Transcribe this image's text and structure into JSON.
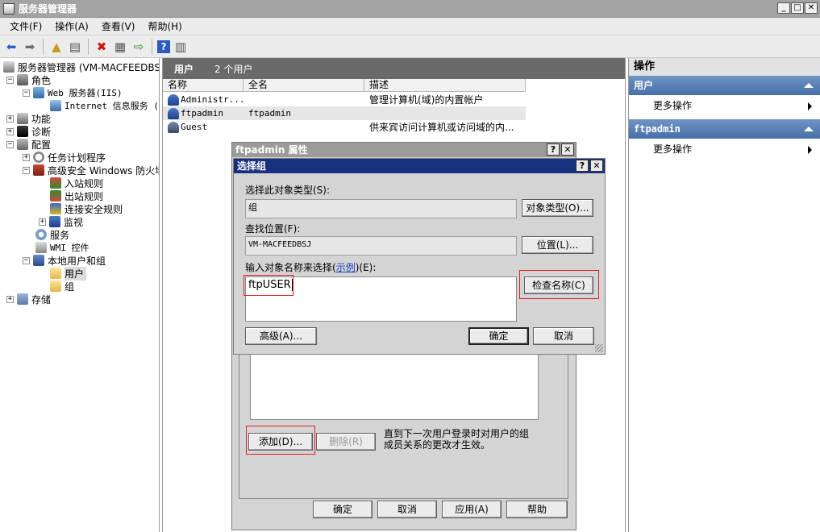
{
  "window": {
    "title": "服务器管理器"
  },
  "menu": [
    "文件(F)",
    "操作(A)",
    "查看(V)",
    "帮助(H)"
  ],
  "tree": {
    "root": "服务器管理器 (VM-MACFEEDBSJ)",
    "roles": "角色",
    "web_server": "Web 服务器(IIS)",
    "iis_manager": "Internet 信息服务 (",
    "features": "功能",
    "diagnostics": "诊断",
    "config": "配置",
    "task_scheduler": "任务计划程序",
    "firewall": "高级安全 Windows 防火墙",
    "inbound": "入站规则",
    "outbound": "出站规则",
    "connection_rules": "连接安全规则",
    "monitor": "监视",
    "services": "服务",
    "wmi": "WMI 控件",
    "local_users_groups": "本地用户和组",
    "users": "用户",
    "groups": "组",
    "storage": "存储"
  },
  "center": {
    "header_title": "用户",
    "header_count": "2 个用户",
    "columns": [
      "名称",
      "全名",
      "描述"
    ],
    "rows": [
      {
        "name": "Administr...",
        "fullname": "",
        "desc": "管理计算机(域)的内置帐户"
      },
      {
        "name": "ftpadmin",
        "fullname": "ftpadmin",
        "desc": ""
      },
      {
        "name": "Guest",
        "fullname": "",
        "desc": "供来宾访问计算机或访问域的内..."
      }
    ]
  },
  "actions": {
    "title": "操作",
    "sections": [
      {
        "header": "用户",
        "item": "更多操作"
      },
      {
        "header": "ftpadmin",
        "item": "更多操作"
      }
    ]
  },
  "properties_dialog": {
    "title": "ftpadmin 属性",
    "add_button": "添加(D)...",
    "remove_button": "删除(R)",
    "note_line1": "直到下一次用户登录时对用户的组",
    "note_line2": "成员关系的更改才生效。",
    "ok": "确定",
    "cancel": "取消",
    "apply": "应用(A)",
    "help": "帮助"
  },
  "select_group_dialog": {
    "title": "选择组",
    "object_type_label": "选择此对象类型(S):",
    "object_type_value": "组",
    "object_type_button": "对象类型(O)...",
    "location_label": "查找位置(F):",
    "location_value": "VM-MACFEEDBSJ",
    "location_button": "位置(L)...",
    "enter_names_label_before": "输入对象名称来选择(",
    "enter_names_link": "示例",
    "enter_names_label_after": ")(E):",
    "names_value": "ftpUSER",
    "check_names_button": "检查名称(C)",
    "advanced_button": "高级(A)...",
    "ok": "确定",
    "cancel": "取消"
  }
}
